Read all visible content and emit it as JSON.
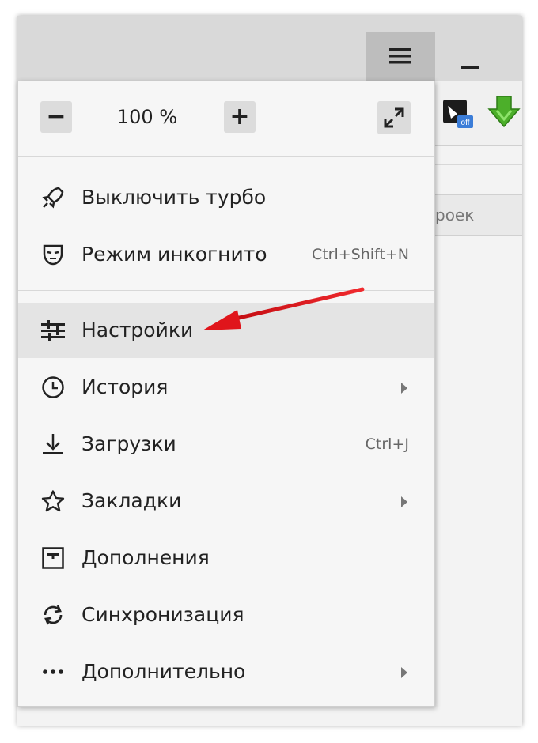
{
  "window": {
    "menu_icon": "hamburger-icon",
    "minimize_icon": "minimize-icon",
    "extensions": [
      "off-extension-icon",
      "download-arrow-icon"
    ],
    "background_search_text": "роек"
  },
  "zoom": {
    "minus": "−",
    "value": "100 %",
    "plus": "+",
    "fullscreen_icon": "fullscreen-icon"
  },
  "menu": {
    "items": [
      {
        "label": "Выключить турбо",
        "icon": "rocket-off-icon",
        "shortcut": "",
        "submenu": false
      },
      {
        "label": "Режим инкогнито",
        "icon": "mask-icon",
        "shortcut": "Ctrl+Shift+N",
        "submenu": false
      },
      {
        "label": "Настройки",
        "icon": "sliders-icon",
        "shortcut": "",
        "submenu": false,
        "highlighted": true
      },
      {
        "label": "История",
        "icon": "clock-icon",
        "shortcut": "",
        "submenu": true
      },
      {
        "label": "Загрузки",
        "icon": "download-icon",
        "shortcut": "Ctrl+J",
        "submenu": false
      },
      {
        "label": "Закладки",
        "icon": "star-icon",
        "shortcut": "",
        "submenu": true
      },
      {
        "label": "Дополнения",
        "icon": "extensions-icon",
        "shortcut": "",
        "submenu": false
      },
      {
        "label": "Синхронизация",
        "icon": "sync-icon",
        "shortcut": "",
        "submenu": false
      },
      {
        "label": "Дополнительно",
        "icon": "more-icon",
        "shortcut": "",
        "submenu": true
      }
    ]
  },
  "colors": {
    "annotation_arrow": "#e0151b",
    "highlight": "#e4e4e4",
    "download_extension": "#4caf2a"
  }
}
